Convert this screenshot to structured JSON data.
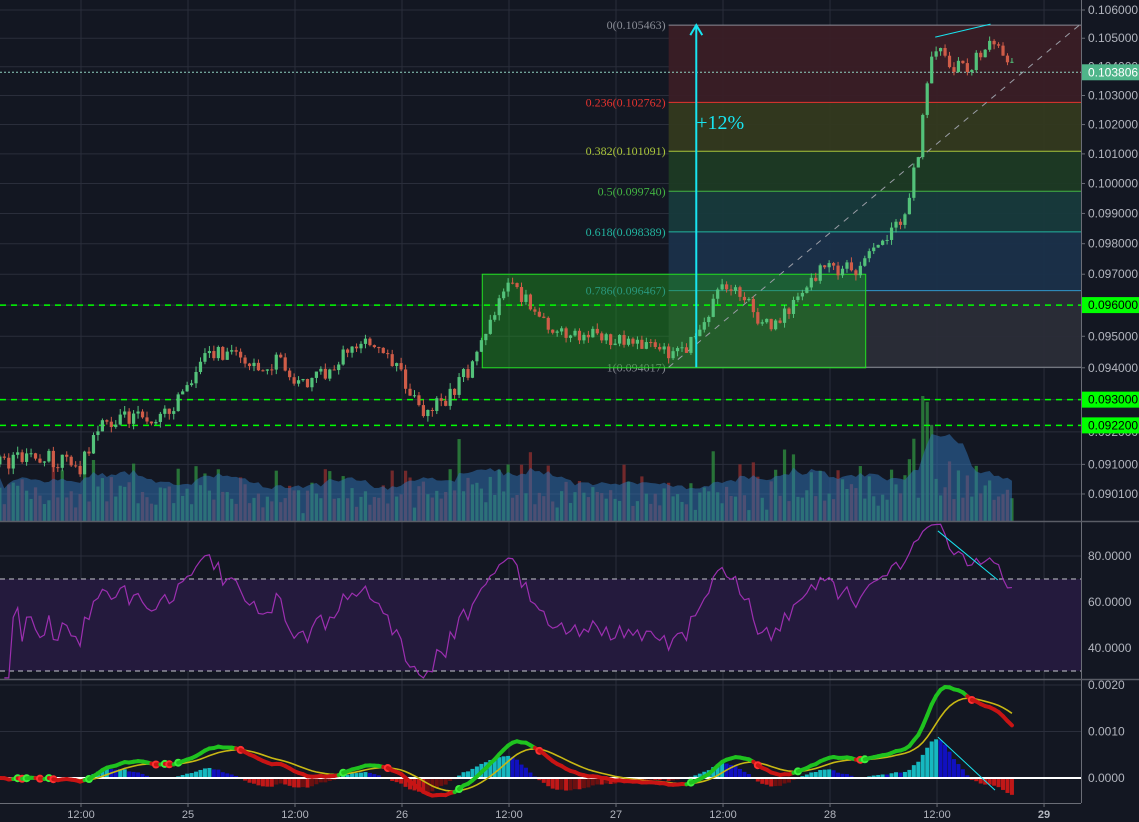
{
  "chart_data": {
    "type": "candlestick",
    "price_scale": "log",
    "colors": {
      "background": "#131722",
      "grid": "#2a2e3b",
      "up": "#53c27a",
      "down": "#cf5c48",
      "volume_up": "#2e8b3e",
      "volume_down": "#8b2e2e",
      "volume_ma": "#2f6fae",
      "rsi": "#9c2fb0",
      "rsi_band": "#241a3d",
      "macd_up": "#1fc21f",
      "macd_down": "#c81414",
      "signal": "#c8b814",
      "hist_up": "#16b8c0",
      "hist_up_weak": "#1010c0",
      "hist_down": "#c01818",
      "hist_down_weak": "#6a1010",
      "level": "#00ff00",
      "last_price": "#4fb58a",
      "cyan": "#18e4f0"
    },
    "price_pane": {
      "ylim": [
        0.0893,
        0.10636
      ],
      "tick_values": [
        0.106,
        0.105,
        0.104,
        0.103,
        0.102,
        0.101,
        0.1,
        0.099,
        0.098,
        0.097,
        0.096,
        0.095,
        0.094,
        0.093,
        0.092,
        0.091,
        0.0901
      ],
      "tick_labels": [
        "0.106000",
        "0.105000",
        "0.104000",
        "0.103000",
        "0.102000",
        "0.101000",
        "0.100000",
        "0.099000",
        "0.098000",
        "0.097000",
        "0.096000",
        "0.095000",
        "0.094000",
        "0.093000",
        "0.092000",
        "0.091000",
        "0.090100"
      ],
      "anchors": [
        [
          2.9,
          0.091
        ],
        [
          5.2,
          0.0912
        ],
        [
          8.5,
          0.0912
        ],
        [
          11.9,
          0.0909
        ],
        [
          14.1,
          0.0922
        ],
        [
          17.5,
          0.0925
        ],
        [
          20.9,
          0.0924
        ],
        [
          23.7,
          0.0933
        ],
        [
          26.5,
          0.0945
        ],
        [
          29.8,
          0.0945
        ],
        [
          32.1,
          0.0937
        ],
        [
          34.3,
          0.0943
        ],
        [
          36.6,
          0.0935
        ],
        [
          38.8,
          0.0937
        ],
        [
          41.6,
          0.0945
        ],
        [
          44.4,
          0.0948
        ],
        [
          47.8,
          0.0938
        ],
        [
          50.6,
          0.0925
        ],
        [
          52.8,
          0.093
        ],
        [
          55.6,
          0.094
        ],
        [
          57.9,
          0.0955
        ],
        [
          60.1,
          0.0967
        ],
        [
          62.4,
          0.096
        ],
        [
          65.7,
          0.095
        ],
        [
          69.1,
          0.0951
        ],
        [
          72.4,
          0.0948
        ],
        [
          75.8,
          0.0947
        ],
        [
          78.6,
          0.0943
        ],
        [
          81.4,
          0.0952
        ],
        [
          83.7,
          0.0965
        ],
        [
          86.5,
          0.0963
        ],
        [
          88.1,
          0.0952
        ],
        [
          91.5,
          0.0958
        ],
        [
          94.9,
          0.0972
        ],
        [
          99.4,
          0.0972
        ],
        [
          101.6,
          0.098
        ],
        [
          104.4,
          0.099
        ],
        [
          105.9,
          0.101
        ],
        [
          106.7,
          0.103
        ],
        [
          107.8,
          0.1048
        ],
        [
          109.5,
          0.104
        ],
        [
          111.7,
          0.104
        ],
        [
          114.0,
          0.1049
        ],
        [
          116.7,
          0.1038
        ]
      ]
    },
    "time_axis": {
      "start_hour": 2.9,
      "end_hour": 116.7,
      "candle_hours": 0.5,
      "tick_hours": [
        12,
        24,
        36,
        48,
        60,
        72,
        84,
        96,
        108,
        120
      ],
      "tick_labels": [
        "12:00",
        "25",
        "12:00",
        "26",
        "12:00",
        "27",
        "12:00",
        "28",
        "12:00",
        "29"
      ]
    },
    "last_price": {
      "value": 0.103806,
      "label": "0.103806"
    },
    "horizontal_levels": [
      {
        "price": 0.096,
        "label": "0.096000"
      },
      {
        "price": 0.093,
        "label": "0.093000"
      },
      {
        "price": 0.0922,
        "label": "0.092200"
      }
    ],
    "fibonacci": {
      "start_hour": 77.9,
      "levels": [
        {
          "ratio": 0,
          "price": 0.105463,
          "label": "0(0.105463)",
          "color": "#8a8d96",
          "fill": "#3a1d26"
        },
        {
          "ratio": 0.236,
          "price": 0.102762,
          "label": "0.236(0.102762)",
          "color": "#e5332f",
          "fill": "#33391f"
        },
        {
          "ratio": 0.382,
          "price": 0.101091,
          "label": "0.382(0.101091)",
          "color": "#a9c43a",
          "fill": "#1c3a24"
        },
        {
          "ratio": 0.5,
          "price": 0.09974,
          "label": "0.5(0.099740)",
          "color": "#43b443",
          "fill": "#173a3c"
        },
        {
          "ratio": 0.618,
          "price": 0.098389,
          "label": "0.618(0.098389)",
          "color": "#22b5a0",
          "fill": "#1a304a"
        },
        {
          "ratio": 0.786,
          "price": 0.096467,
          "label": "0.786(0.096467)",
          "color": "#3296c8",
          "fill": "#2a2d38"
        },
        {
          "ratio": 1,
          "price": 0.094017,
          "label": "1(0.094017)",
          "color": "#8a8d96",
          "fill": ""
        }
      ]
    },
    "rectangle": {
      "from_hour": 57.0,
      "to_hour": 100.0,
      "top": 0.097,
      "bottom": 0.094
    },
    "arrow": {
      "hour": 81.0,
      "from": 0.094017,
      "to": 0.105463,
      "label": "+12%"
    },
    "trend_line": {
      "from": [
        77.9,
        0.094017
      ],
      "to": [
        124.1,
        0.1055
      ]
    },
    "price_divergence": {
      "from": [
        107.8,
        0.10504
      ],
      "to": [
        114.0,
        0.1055
      ]
    },
    "rsi": {
      "period": 14,
      "ylim": [
        26.5,
        94.8
      ],
      "band": [
        30,
        70
      ],
      "tick_values": [
        80,
        60,
        40
      ],
      "tick_labels": [
        "80.0000",
        "60.0000",
        "40.0000"
      ],
      "divergence": {
        "from": [
          108.1,
          90.9
        ],
        "to": [
          114.8,
          69.6
        ]
      }
    },
    "macd": {
      "fast": 12,
      "slow": 26,
      "signal": 9,
      "ylim": [
        -0.00052,
        0.0021
      ],
      "tick_values": [
        0.002,
        0.001,
        0
      ],
      "tick_labels": [
        "0.0020",
        "0.0010",
        "0.0000"
      ],
      "divergence": {
        "from": [
          108.1,
          0.00088
        ],
        "to": [
          114.5,
          -0.00026
        ]
      }
    }
  }
}
